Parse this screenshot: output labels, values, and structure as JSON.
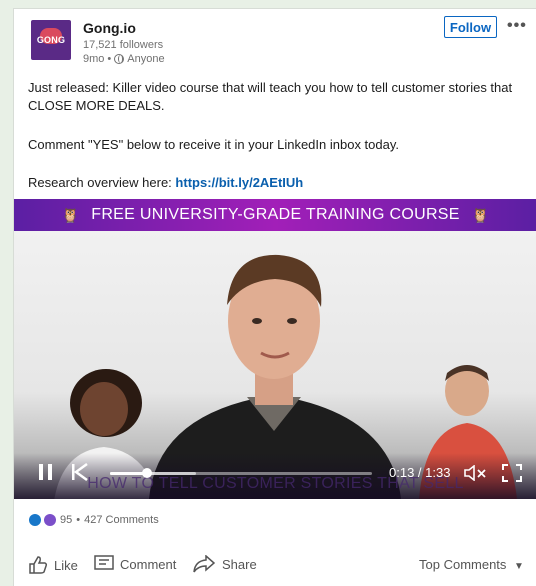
{
  "post": {
    "company_name": "Gong.io",
    "logo_text": "GONG",
    "followers": "17,521 followers",
    "age": "9mo",
    "visibility": "Anyone",
    "follow_label": "Follow",
    "more_label": "•••",
    "body_line1": "Just released: Killer video course that will teach you how to tell customer stories that",
    "body_line2": "CLOSE MORE DEALS.",
    "body_line3": "Comment \"YES\" below to receive it in your LinkedIn inbox today.",
    "research_label": "Research overview here:",
    "research_link": "https://bit.ly/2AEtIUh"
  },
  "video": {
    "banner_text": "FREE UNIVERSITY-GRADE TRAINING COURSE",
    "subtitle": "HOW TO TELL CUSTOMER STORIES THAT SELL",
    "time": "0:13 / 1:33",
    "progress": 0.14,
    "buffered": 0.33
  },
  "social": {
    "reaction_count": "95",
    "separator": "•",
    "comments": "427 Comments"
  },
  "actions": {
    "like": "Like",
    "comment": "Comment",
    "share": "Share",
    "sort": "Top Comments"
  },
  "colors": {
    "link": "#0a5fad",
    "brand": "#5a2a86",
    "banner": "#a21fb8"
  }
}
